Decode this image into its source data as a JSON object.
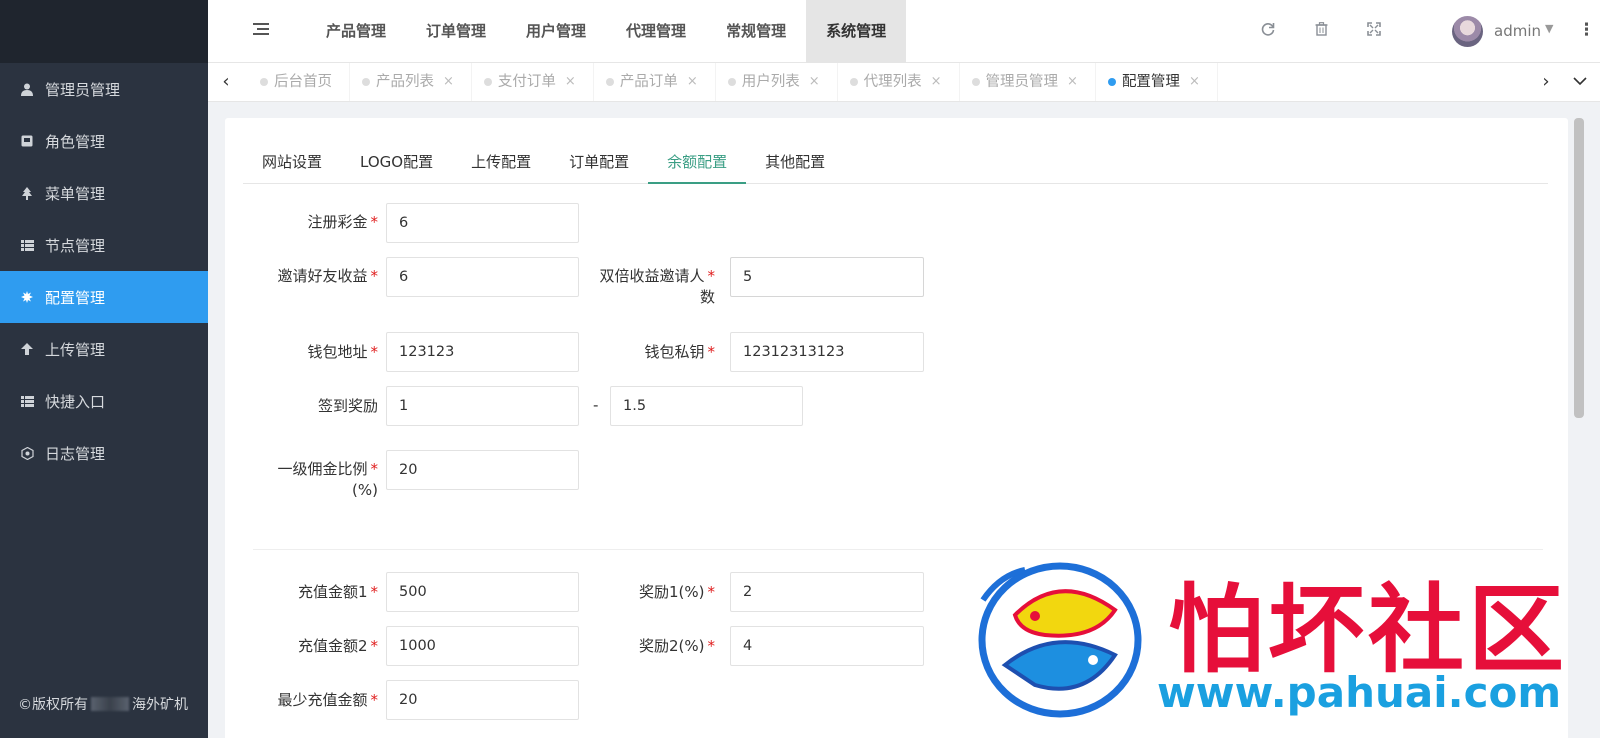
{
  "sidebar": {
    "items": [
      {
        "label": "管理员管理",
        "icon": "user-icon"
      },
      {
        "label": "角色管理",
        "icon": "role-icon"
      },
      {
        "label": "菜单管理",
        "icon": "tree-icon"
      },
      {
        "label": "节点管理",
        "icon": "list-icon"
      },
      {
        "label": "配置管理",
        "icon": "gear-icon"
      },
      {
        "label": "上传管理",
        "icon": "upload-icon"
      },
      {
        "label": "快捷入口",
        "icon": "list-icon"
      },
      {
        "label": "日志管理",
        "icon": "log-icon"
      }
    ],
    "active_index": 4,
    "copyright_prefix": "©版权所有",
    "copyright_suffix": "海外矿机"
  },
  "topnav": {
    "items": [
      "产品管理",
      "订单管理",
      "用户管理",
      "代理管理",
      "常规管理",
      "系统管理"
    ],
    "active_index": 5,
    "admin_name": "admin"
  },
  "tabs": [
    {
      "label": "后台首页",
      "closable": false
    },
    {
      "label": "产品列表",
      "closable": true
    },
    {
      "label": "支付订单",
      "closable": true
    },
    {
      "label": "产品订单",
      "closable": true
    },
    {
      "label": "用户列表",
      "closable": true
    },
    {
      "label": "代理列表",
      "closable": true
    },
    {
      "label": "管理员管理",
      "closable": true
    },
    {
      "label": "配置管理",
      "closable": true,
      "active": true
    }
  ],
  "subtabs": [
    "网站设置",
    "LOGO配置",
    "上传配置",
    "订单配置",
    "余额配置",
    "其他配置"
  ],
  "subtab_active": 4,
  "form": {
    "register_bonus": {
      "label": "注册彩金",
      "value": "6"
    },
    "invite_income": {
      "label": "邀请好友收益",
      "value": "6"
    },
    "double_income_invites": {
      "label_line1": "双倍收益邀请人",
      "label_line2": "数",
      "value": "5"
    },
    "wallet_address": {
      "label": "钱包地址",
      "value": "123123"
    },
    "wallet_key": {
      "label": "钱包私钥",
      "value": "12312313123"
    },
    "signin_reward": {
      "label": "签到奖励",
      "min": "1",
      "dash": "-",
      "max": "1.5"
    },
    "commission_ratio": {
      "label_line1": "一级佣金比例",
      "label_line2": "(%)",
      "value": "20"
    },
    "recharge1": {
      "label": "充值金额1",
      "value": "500"
    },
    "reward1": {
      "label": "奖励1(%)",
      "value": "2"
    },
    "recharge2": {
      "label": "充值金额2",
      "value": "1000"
    },
    "reward2": {
      "label": "奖励2(%)",
      "value": "4"
    },
    "min_recharge": {
      "label": "最少充值金额",
      "value": "20"
    }
  },
  "watermark": {
    "text": "怕坏社区",
    "url": "www.pahuai.com"
  },
  "colors": {
    "sidebar_bg": "#2b3340",
    "active_blue": "#2f9cf0",
    "subtab_green": "#3a9e84",
    "required_red": "#e02020"
  }
}
